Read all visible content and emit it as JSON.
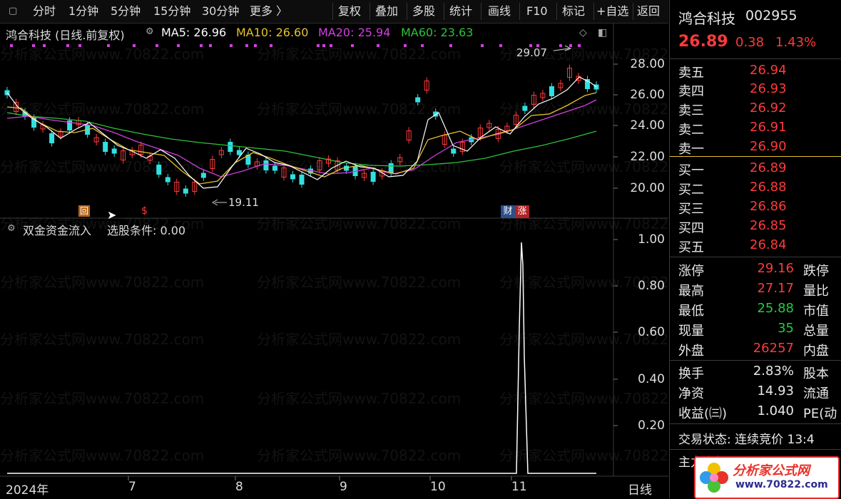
{
  "toolbar": {
    "periods": [
      "分时",
      "1分钟",
      "5分钟",
      "15分钟",
      "30分钟",
      "更多 〉"
    ],
    "actions": [
      "复权",
      "叠加",
      "多股",
      "统计",
      "画线",
      "F10",
      "标记",
      "+自选",
      "返回"
    ]
  },
  "main_chart": {
    "title": "鸿合科技 (日线.前复权)",
    "ma5": "MA5: 26.96",
    "ma10": "MA10: 26.60",
    "ma20": "MA20: 25.94",
    "ma60": "MA60: 23.63",
    "high_label": "29.07",
    "low_label": "19.11",
    "y_ticks": [
      "28.00",
      "26.00",
      "24.00",
      "22.00",
      "20.00"
    ],
    "markers": {
      "hui": "回",
      "dollar": "$",
      "cai": "财",
      "zhang": "涨"
    }
  },
  "indicator": {
    "title": "双金资金流入",
    "condition": "选股条件: 0.00",
    "y_ticks": [
      "1.00",
      "0.80",
      "0.60",
      "0.40",
      "0.20"
    ]
  },
  "x_axis": {
    "labels": [
      "2024年",
      "7",
      "8",
      "9",
      "10",
      "11"
    ],
    "period": "日线"
  },
  "colors": {
    "ma5": "#ffffff",
    "ma10": "#e6c229",
    "ma20": "#d23fe0",
    "ma60": "#2ec23a",
    "up": "#ff3a3a",
    "down": "#32e0e0"
  },
  "quote": {
    "name": "鸿合科技",
    "code": "002955",
    "price": "26.89",
    "change": "0.38",
    "change_pct": "1.43%",
    "asks": [
      {
        "label": "卖五",
        "price": "26.94"
      },
      {
        "label": "卖四",
        "price": "26.93"
      },
      {
        "label": "卖三",
        "price": "26.92"
      },
      {
        "label": "卖二",
        "price": "26.91"
      },
      {
        "label": "卖一",
        "price": "26.90"
      }
    ],
    "bids": [
      {
        "label": "买一",
        "price": "26.89"
      },
      {
        "label": "买二",
        "price": "26.88"
      },
      {
        "label": "买三",
        "price": "26.86"
      },
      {
        "label": "买四",
        "price": "26.85"
      },
      {
        "label": "买五",
        "price": "26.84"
      }
    ],
    "stats1": [
      {
        "label": "涨停",
        "value": "29.16",
        "label2": "跌停"
      },
      {
        "label": "最高",
        "value": "27.17",
        "label2": "量比"
      },
      {
        "label": "最低",
        "value": "25.88",
        "label2": "市值"
      },
      {
        "label": "现量",
        "value": "35",
        "label2": "总量"
      },
      {
        "label": "外盘",
        "value": "26257",
        "label2": "内盘"
      }
    ],
    "stats2": [
      {
        "label": "换手",
        "value": "2.83%",
        "label2": "股本"
      },
      {
        "label": "净资",
        "value": "14.93",
        "label2": "流通"
      },
      {
        "label": "收益(㈢)",
        "value": "1.040",
        "label2": "PE(动"
      }
    ],
    "trade_status": "交易状态: 连续竞价 13:4",
    "main_flow": "主力净额",
    "logo_text": "分析家公式网",
    "logo_url": "www.70822.com"
  },
  "watermark": "分析家公式网www.70822.com"
}
